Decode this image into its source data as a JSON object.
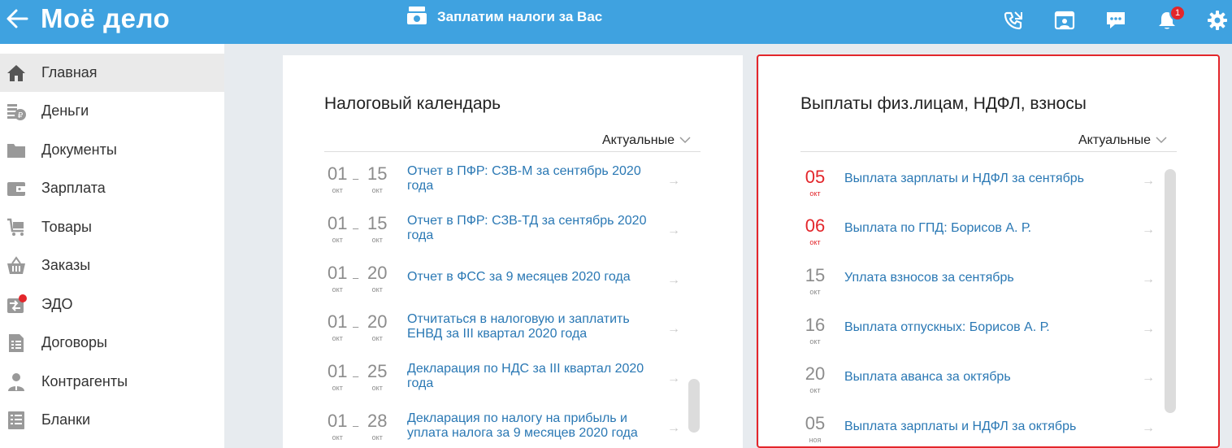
{
  "header": {
    "logo": "Моё дело",
    "center_title": "Заплатим налоги за Вас",
    "notification_count": "1",
    "bg_color": "#3fa2e0"
  },
  "sidebar": {
    "items": [
      {
        "label": "Главная",
        "icon": "home-icon",
        "active": true
      },
      {
        "label": "Деньги",
        "icon": "money-icon"
      },
      {
        "label": "Документы",
        "icon": "folder-icon"
      },
      {
        "label": "Зарплата",
        "icon": "wallet-icon"
      },
      {
        "label": "Товары",
        "icon": "cart-icon"
      },
      {
        "label": "Заказы",
        "icon": "basket-icon"
      },
      {
        "label": "ЭДО",
        "icon": "edo-icon",
        "dot": true
      },
      {
        "label": "Договоры",
        "icon": "contract-icon"
      },
      {
        "label": "Контрагенты",
        "icon": "person-icon"
      },
      {
        "label": "Бланки",
        "icon": "forms-icon"
      }
    ]
  },
  "tax_calendar": {
    "title": "Налоговый календарь",
    "filter": "Актуальные",
    "rows": [
      {
        "from_day": "01",
        "from_month": "окт",
        "to_day": "15",
        "to_month": "окт",
        "line1": "Отчет в ПФР: СЗВ-М за сентябрь 2020",
        "line2": "года"
      },
      {
        "from_day": "01",
        "from_month": "окт",
        "to_day": "15",
        "to_month": "окт",
        "line1": "Отчет в ПФР: СЗВ-ТД за сентябрь 2020",
        "line2": "года"
      },
      {
        "from_day": "01",
        "from_month": "окт",
        "to_day": "20",
        "to_month": "окт",
        "line1": "Отчет в ФСС за 9 месяцев 2020 года",
        "line2": ""
      },
      {
        "from_day": "01",
        "from_month": "окт",
        "to_day": "20",
        "to_month": "окт",
        "line1": "Отчитаться в налоговую и заплатить",
        "line2": "ЕНВД за III квартал 2020 года"
      },
      {
        "from_day": "01",
        "from_month": "окт",
        "to_day": "25",
        "to_month": "окт",
        "line1": "Декларация по НДС за III квартал 2020",
        "line2": "года"
      },
      {
        "from_day": "01",
        "from_month": "окт",
        "to_day": "28",
        "to_month": "окт",
        "line1": "Декларация по налогу на прибыль и",
        "line2": "уплата налога за 9 месяцев 2020 года"
      }
    ]
  },
  "payments": {
    "title": "Выплаты физ.лицам, НДФЛ, взносы",
    "filter": "Актуальные",
    "rows": [
      {
        "day": "05",
        "month": "окт",
        "title": "Выплата зарплаты и НДФЛ за сентябрь",
        "overdue": true
      },
      {
        "day": "06",
        "month": "окт",
        "title": "Выплата по ГПД: Борисов А. Р.",
        "overdue": true
      },
      {
        "day": "15",
        "month": "окт",
        "title": "Уплата взносов за сентябрь",
        "overdue": false
      },
      {
        "day": "16",
        "month": "окт",
        "title": "Выплата отпускных: Борисов А. Р.",
        "overdue": false
      },
      {
        "day": "20",
        "month": "окт",
        "title": "Выплата аванса за октябрь",
        "overdue": false
      },
      {
        "day": "05",
        "month": "ноя",
        "title": "Выплата зарплаты и НДФЛ за октябрь",
        "overdue": false
      }
    ]
  },
  "colors": {
    "link": "#2a78b4",
    "overdue": "#e3262b",
    "highlight_outline": "#e3262b"
  }
}
